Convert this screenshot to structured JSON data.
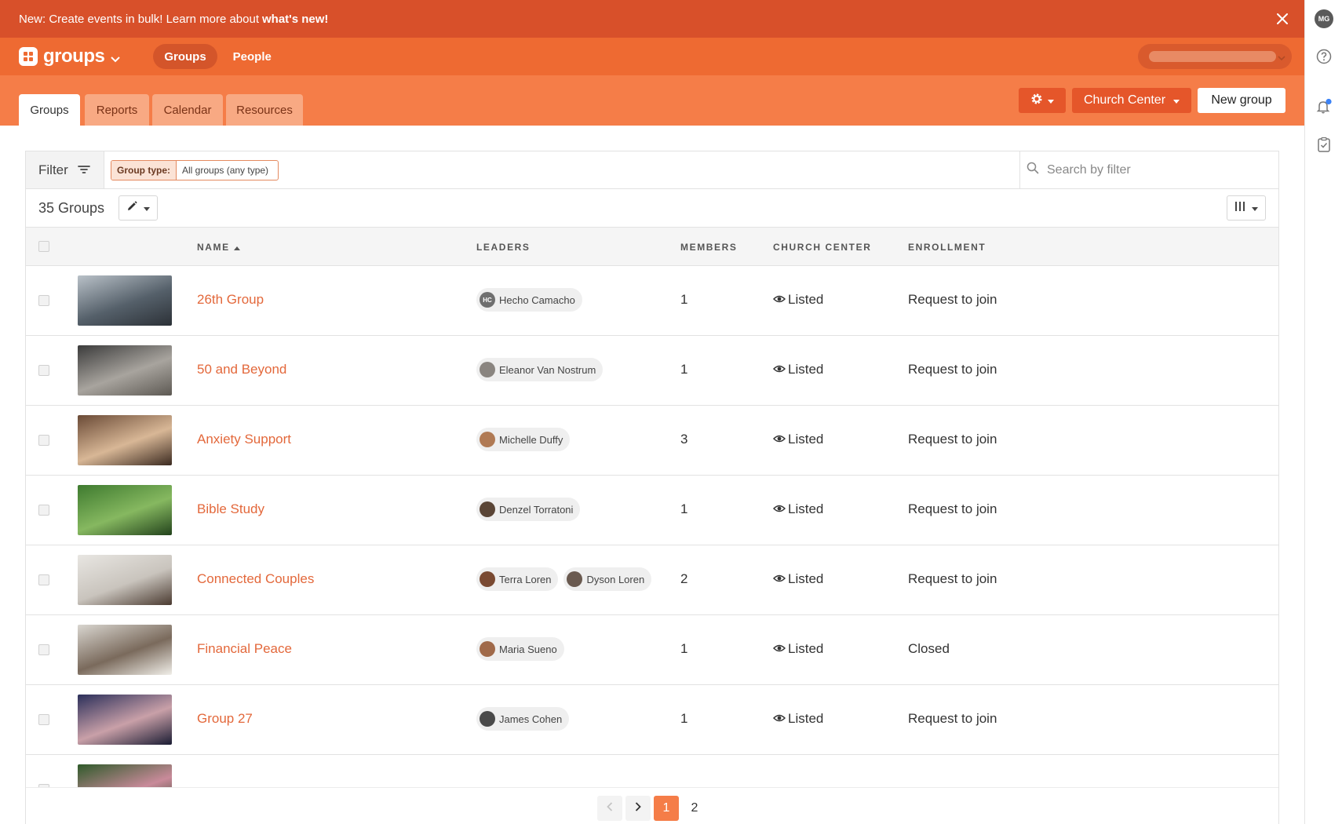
{
  "banner": {
    "text": "New: Create events in bulk! Learn more about",
    "link": "what's new!"
  },
  "topnav": {
    "app_name": "groups",
    "items": [
      {
        "label": "Groups",
        "active": true
      },
      {
        "label": "People",
        "active": false
      }
    ]
  },
  "tabs": [
    {
      "label": "Groups",
      "active": true
    },
    {
      "label": "Reports",
      "active": false
    },
    {
      "label": "Calendar",
      "active": false
    },
    {
      "label": "Resources",
      "active": false
    }
  ],
  "actions": {
    "church_center_label": "Church Center",
    "new_group_label": "New group"
  },
  "rail": {
    "user_initials": "MG"
  },
  "filter": {
    "label": "Filter",
    "chip_key": "Group type:",
    "chip_value": "All groups (any type)",
    "search_placeholder": "Search by filter"
  },
  "list": {
    "count_label": "35 Groups"
  },
  "columns": {
    "name": "NAME",
    "leaders": "LEADERS",
    "members": "MEMBERS",
    "church_center": "CHURCH CENTER",
    "enrollment": "ENROLLMENT"
  },
  "groups": [
    {
      "name": "26th Group",
      "leaders": [
        {
          "name": "Hecho Camacho",
          "initials": "HC",
          "color": "#6f6f6f"
        }
      ],
      "members": "1",
      "church_center": "Listed",
      "enrollment": "Request to join",
      "thumb": [
        "#b9c1c8",
        "#55606a",
        "#2c3137"
      ]
    },
    {
      "name": "50 and Beyond",
      "leaders": [
        {
          "name": "Eleanor Van Nostrum",
          "initials": "",
          "color": "#8a8580"
        }
      ],
      "members": "1",
      "church_center": "Listed",
      "enrollment": "Request to join",
      "thumb": [
        "#3b3b3b",
        "#a8a49e",
        "#5d5953"
      ]
    },
    {
      "name": "Anxiety Support",
      "leaders": [
        {
          "name": "Michelle Duffy",
          "initials": "",
          "color": "#b07a54"
        }
      ],
      "members": "3",
      "church_center": "Listed",
      "enrollment": "Request to join",
      "thumb": [
        "#6a4a36",
        "#d8b796",
        "#3b2a20"
      ]
    },
    {
      "name": "Bible Study",
      "leaders": [
        {
          "name": "Denzel Torratoni",
          "initials": "",
          "color": "#5a4536"
        }
      ],
      "members": "1",
      "church_center": "Listed",
      "enrollment": "Request to join",
      "thumb": [
        "#3e7a2f",
        "#86b860",
        "#23431c"
      ]
    },
    {
      "name": "Connected Couples",
      "leaders": [
        {
          "name": "Terra Loren",
          "initials": "",
          "color": "#7a4a32"
        },
        {
          "name": "Dyson Loren",
          "initials": "",
          "color": "#6a5a50"
        }
      ],
      "members": "2",
      "church_center": "Listed",
      "enrollment": "Request to join",
      "thumb": [
        "#e8e6e2",
        "#c9c4bd",
        "#4a3a30"
      ]
    },
    {
      "name": "Financial Peace",
      "leaders": [
        {
          "name": "Maria Sueno",
          "initials": "",
          "color": "#a06a4a"
        }
      ],
      "members": "1",
      "church_center": "Listed",
      "enrollment": "Closed",
      "thumb": [
        "#d9d6d0",
        "#7a6a5c",
        "#f1efe9"
      ]
    },
    {
      "name": "Group 27",
      "leaders": [
        {
          "name": "James Cohen",
          "initials": "",
          "color": "#4a4a4a"
        }
      ],
      "members": "1",
      "church_center": "Listed",
      "enrollment": "Request to join",
      "thumb": [
        "#2b2f5a",
        "#c9a0a8",
        "#1a1c33"
      ]
    },
    {
      "name": "",
      "leaders": [],
      "members": "",
      "church_center": "",
      "enrollment": "",
      "thumb": [
        "#2f5a2a",
        "#c98a9a",
        "#1f3a1c"
      ]
    }
  ],
  "pagination": {
    "current": "1",
    "next_page": "2"
  }
}
